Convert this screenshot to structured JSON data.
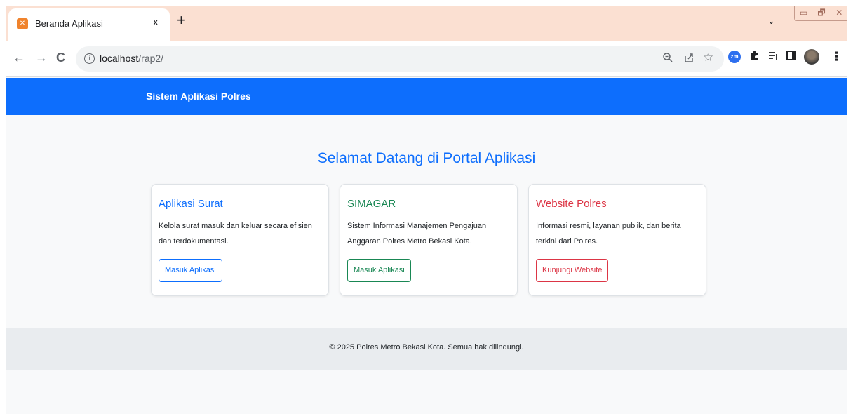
{
  "browser": {
    "tab_title": "Beranda Aplikasi",
    "tab_close": "x",
    "new_tab": "+",
    "dropdown": "⌄",
    "window_buttons": [
      "▭",
      "🗗",
      "✕"
    ],
    "url_host": "localhost",
    "url_path": "/rap2/",
    "back": "←",
    "forward": "→",
    "reload": "C",
    "info": "i",
    "icons": [
      "zoom-icon",
      "share-icon",
      "bookmark-star-icon",
      "zoom-extension-icon",
      "puzzle-extensions-icon",
      "reading-list-icon",
      "side-panel-icon",
      "profile-avatar",
      "menu-kebab-icon"
    ]
  },
  "navbar": {
    "brand": "Sistem Aplikasi Polres",
    "color": "#0d6efd"
  },
  "main": {
    "heading": "Selamat Datang di Portal Aplikasi",
    "cards": [
      {
        "title": "Aplikasi Surat",
        "text": "Kelola surat masuk dan keluar secara efisien dan terdokumentasi.",
        "button": "Masuk Aplikasi",
        "color": "#0d6efd"
      },
      {
        "title": "SIMAGAR",
        "text": "Sistem Informasi Manajemen Pengajuan Anggaran Polres Metro Bekasi Kota.",
        "button": "Masuk Aplikasi",
        "color": "#198754"
      },
      {
        "title": "Website Polres",
        "text": "Informasi resmi, layanan publik, dan berita terkini dari Polres.",
        "button": "Kunjungi Website",
        "color": "#dc3545"
      }
    ]
  },
  "footer": {
    "text": "© 2025 Polres Metro Bekasi Kota. Semua hak dilindungi."
  }
}
